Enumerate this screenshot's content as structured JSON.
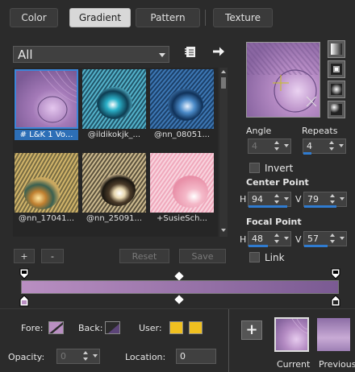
{
  "tabs": [
    {
      "label": "Color",
      "active": false
    },
    {
      "label": "Gradient",
      "active": true
    },
    {
      "label": "Pattern",
      "active": false
    },
    {
      "label": "Texture",
      "active": false
    }
  ],
  "category": {
    "value": "All"
  },
  "thumbnails": [
    {
      "label": "# L&K 1 Vo...",
      "selected": true
    },
    {
      "label": "@ildikokjk_...",
      "selected": false
    },
    {
      "label": "@nn_08051...",
      "selected": false
    },
    {
      "label": "@nn_17041...",
      "selected": false
    },
    {
      "label": "@nn_25091...",
      "selected": false
    },
    {
      "label": "+SusieSch...",
      "selected": false
    }
  ],
  "gallery_buttons": {
    "add": "+",
    "remove": "-",
    "reset": "Reset",
    "save": "Save"
  },
  "angle": {
    "label": "Angle",
    "value": "4"
  },
  "repeats": {
    "label": "Repeats",
    "value": "4"
  },
  "invert": {
    "label": "Invert",
    "checked": false
  },
  "center_point": {
    "label": "Center Point",
    "h_label": "H",
    "h": "94",
    "v_label": "V",
    "v": "79"
  },
  "focal_point": {
    "label": "Focal Point",
    "h_label": "H",
    "h": "48",
    "v_label": "V",
    "v": "57"
  },
  "link": {
    "label": "Link",
    "checked": false
  },
  "gradient_colors": {
    "start": "#b98fc2",
    "end": "#7a5a92"
  },
  "fore": {
    "label": "Fore:",
    "color": "#b98fc2"
  },
  "back": {
    "label": "Back:",
    "color": "#5c4478"
  },
  "user": {
    "label": "User:",
    "color1": "#f0c020",
    "color2": "#f0c020"
  },
  "opacity": {
    "label": "Opacity:",
    "value": "0"
  },
  "location": {
    "label": "Location:",
    "value": "0"
  },
  "add_button": "+",
  "current": {
    "label": "Current"
  },
  "previous": {
    "label": "Previous"
  }
}
